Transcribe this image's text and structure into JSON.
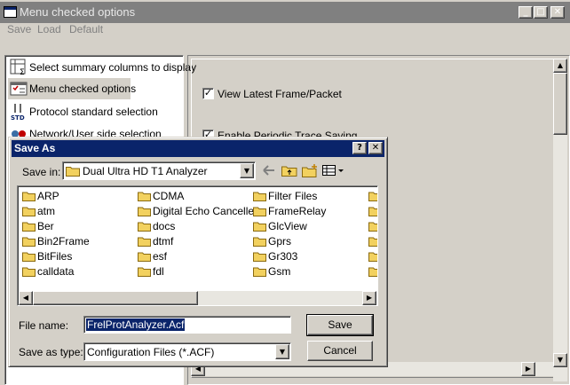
{
  "window": {
    "title": "Menu checked options",
    "controls": {
      "minimize": "_",
      "maximize": "□",
      "close": "✕"
    }
  },
  "menu": {
    "items": [
      "Save",
      "Load",
      "Default"
    ]
  },
  "sidebar": {
    "items": [
      {
        "label": "Select summary columns to display",
        "icon": "summary-columns-icon"
      },
      {
        "label": "Menu checked options",
        "icon": "menu-checked-icon",
        "selected": true
      },
      {
        "label": "Protocol standard selection",
        "icon": "protocol-standard-icon"
      },
      {
        "label": "Network/User side selection",
        "icon": "network-side-icon"
      }
    ]
  },
  "options": [
    {
      "label": "View Latest Frame/Packet",
      "checked": true
    },
    {
      "label": "Enable Periodic Trace Saving",
      "checked": true
    }
  ],
  "dialog": {
    "title": "Save As",
    "help": "?",
    "close": "✕",
    "save_in_label": "Save in:",
    "save_in_value": "Dual Ultra HD T1 Analyzer",
    "files": [
      [
        "ARP",
        "atm",
        "Ber",
        "Bin2Frame",
        "BitFiles",
        "calldata"
      ],
      [
        "CDMA",
        "Digital Echo Canceller",
        "docs",
        "dtmf",
        "esf",
        "fdl"
      ],
      [
        "Filter Files",
        "FrameRelay",
        "GlcView",
        "Gprs",
        "Gr303",
        "Gsm"
      ]
    ],
    "file_name_label": "File name:",
    "file_name_value": "FrelProtAnalyzer.Acf",
    "save_as_type_label": "Save as type:",
    "save_as_type_value": "Configuration Files (*.ACF)",
    "save_button": "Save",
    "cancel_button": "Cancel"
  },
  "colors": {
    "title_active": "#0a246a",
    "title_inactive": "#808080",
    "face": "#d4d0c8",
    "folder": "#f2d15f"
  }
}
